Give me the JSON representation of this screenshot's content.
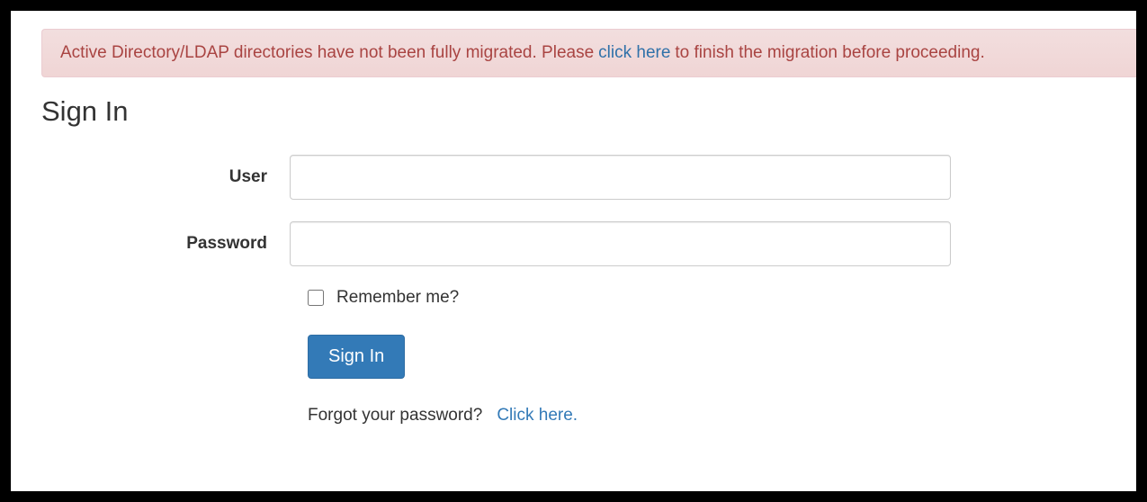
{
  "alert": {
    "text_before": "Active Directory/LDAP directories have not been fully migrated. Please",
    "link_text": "click here",
    "text_after": "to finish the migration before proceeding."
  },
  "heading": "Sign In",
  "form": {
    "user_label": "User",
    "user_value": "",
    "password_label": "Password",
    "password_value": "",
    "remember_label": "Remember me?",
    "remember_checked": false,
    "submit_label": "Sign In"
  },
  "forgot": {
    "text": "Forgot your password?",
    "link": "Click here."
  }
}
